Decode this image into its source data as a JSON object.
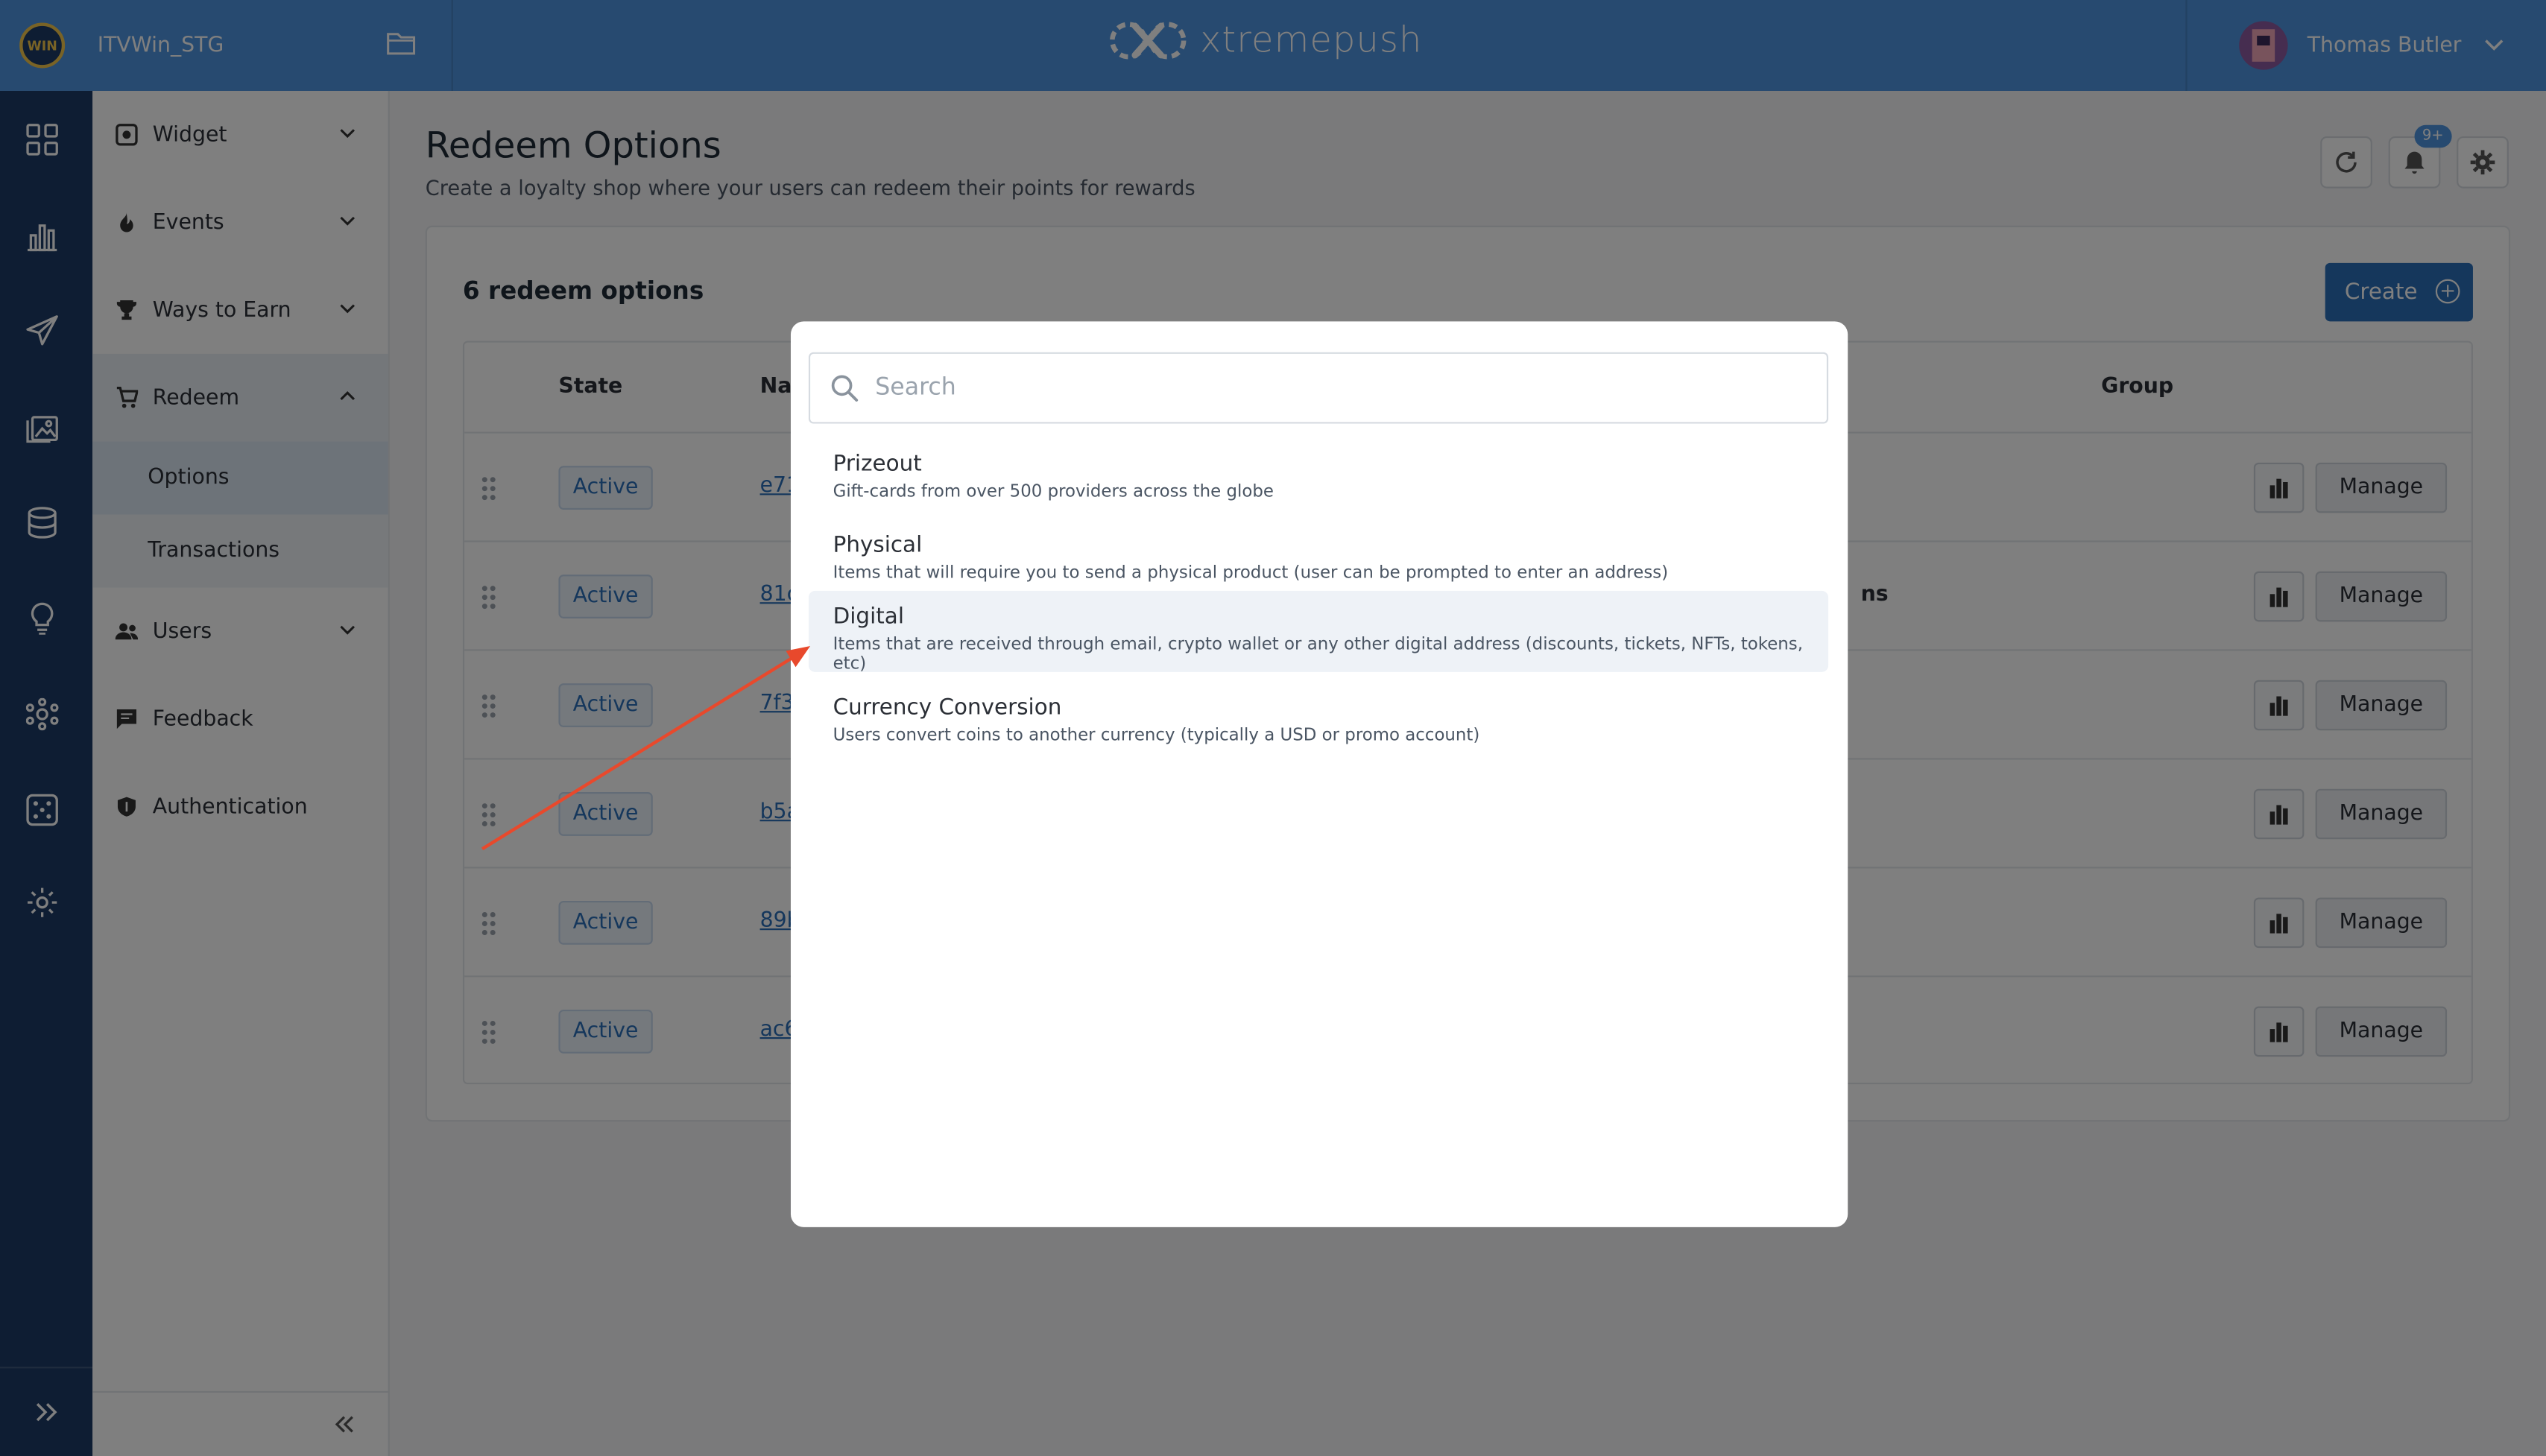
{
  "header": {
    "project_logo_text": "WIN",
    "project_name": "ITVWin_STG",
    "brand_name": "xtremepush",
    "user_name": "Thomas Butler"
  },
  "rail": {
    "icons": [
      "dashboard-icon",
      "analytics-icon",
      "campaigns-icon",
      "content-icon",
      "data-icon",
      "insights-icon",
      "integrations-icon",
      "gaming-icon",
      "settings-icon"
    ]
  },
  "menu": {
    "items": [
      {
        "label": "Widget"
      },
      {
        "label": "Events"
      },
      {
        "label": "Ways to Earn"
      },
      {
        "label": "Redeem"
      },
      {
        "label": "Users"
      },
      {
        "label": "Feedback"
      },
      {
        "label": "Authentication"
      }
    ],
    "sub_items": [
      {
        "label": "Options"
      },
      {
        "label": "Transactions"
      }
    ]
  },
  "page": {
    "title": "Redeem Options",
    "subtitle": "Create a loyalty shop where your users can redeem their points for rewards",
    "notification_badge": "9+"
  },
  "card": {
    "count_label": "6 redeem options",
    "create_label": "Create",
    "columns": {
      "state": "State",
      "name": "Na",
      "group": "Group"
    },
    "rows": [
      {
        "state": "Active",
        "name": "e71",
        "extra": "",
        "manage": "Manage"
      },
      {
        "state": "Active",
        "name": "81c",
        "extra": "ns",
        "manage": "Manage"
      },
      {
        "state": "Active",
        "name": "7f3",
        "extra": "",
        "manage": "Manage"
      },
      {
        "state": "Active",
        "name": "b5a",
        "extra": "",
        "manage": "Manage"
      },
      {
        "state": "Active",
        "name": "89b",
        "extra": "",
        "manage": "Manage"
      },
      {
        "state": "Active",
        "name": "ac6",
        "extra": "",
        "manage": "Manage"
      }
    ]
  },
  "modal": {
    "search_placeholder": "Search",
    "options": [
      {
        "title": "Prizeout",
        "desc": "Gift-cards from over 500 providers across the globe"
      },
      {
        "title": "Physical",
        "desc": "Items that will require you to send a physical product (user can be prompted to enter an address)"
      },
      {
        "title": "Digital",
        "desc": "Items that are received through email, crypto wallet or any other digital address (discounts, tickets, NFTs, tokens, etc)"
      },
      {
        "title": "Currency Conversion",
        "desc": "Users convert coins to another currency (typically a USD or promo account)"
      }
    ]
  },
  "colors": {
    "topbar": "#4f95e0",
    "rail": "#1d3b67",
    "accent": "#2b6fb8",
    "annotation_arrow": "#e8492c"
  }
}
